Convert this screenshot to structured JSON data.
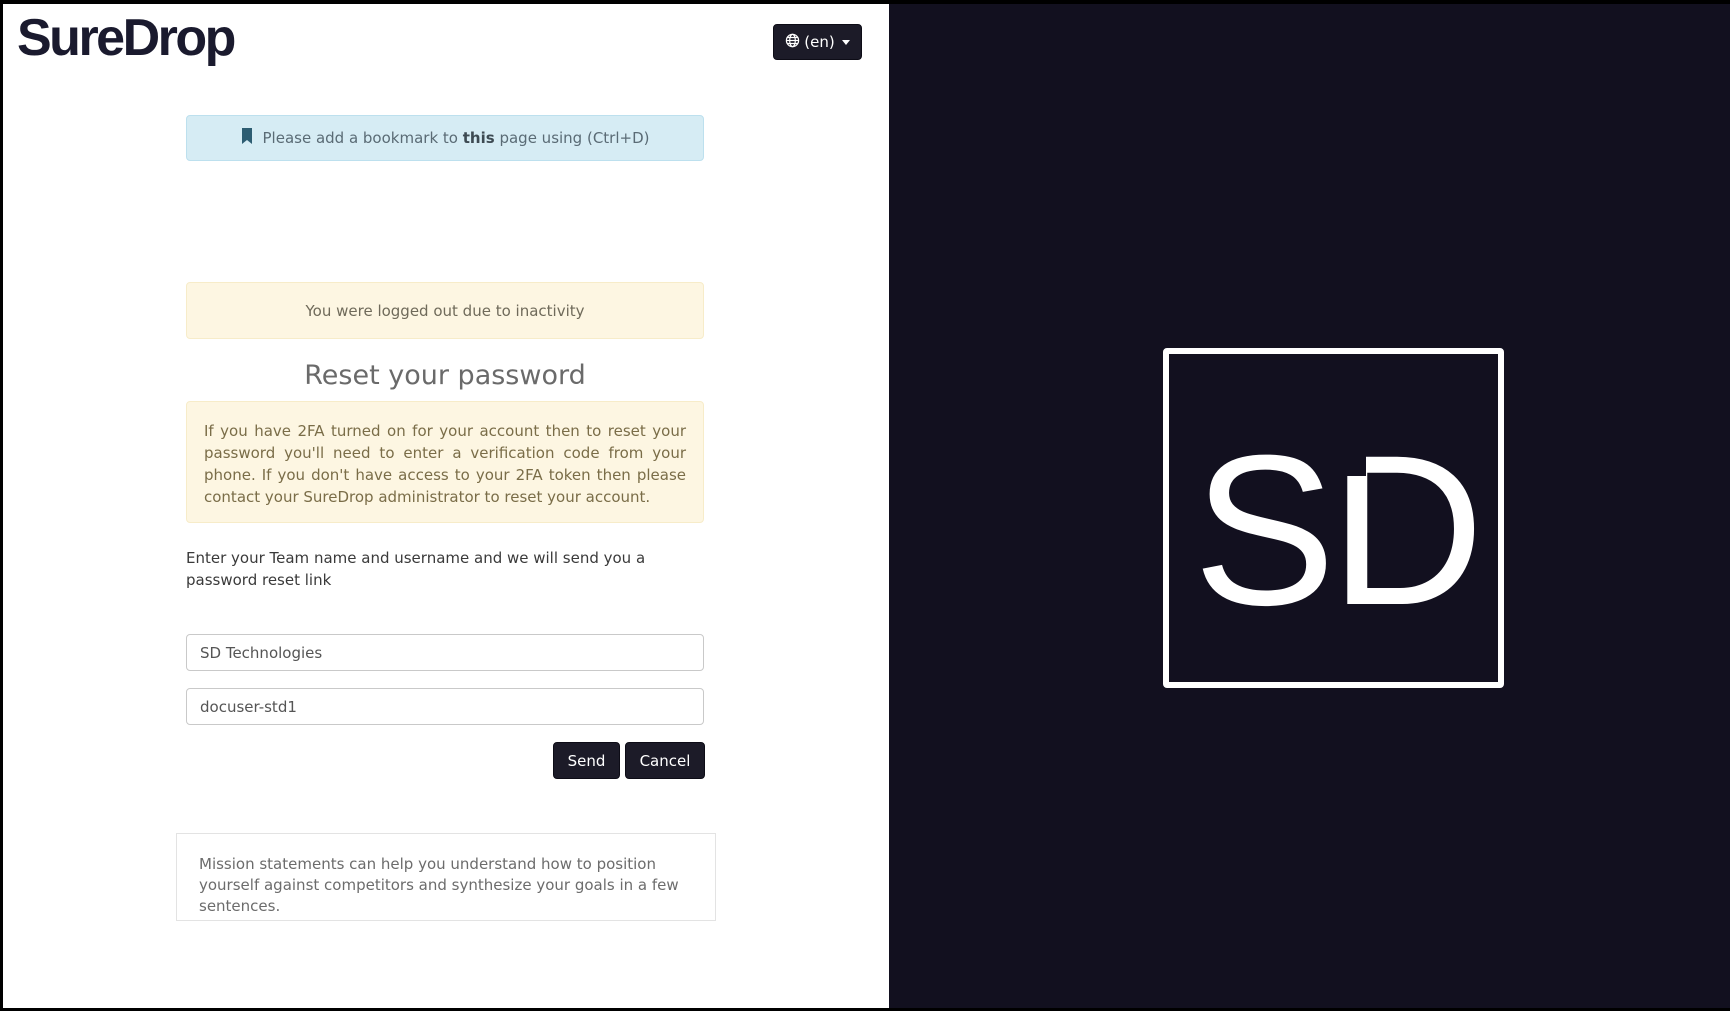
{
  "app": {
    "brand": "SureDrop"
  },
  "header": {
    "language_label": "(en)"
  },
  "alerts": {
    "bookmark_pre": "Please add a bookmark to",
    "bookmark_bold": "this",
    "bookmark_post": "page using (Ctrl+D)",
    "logged_out": "You were logged out due to inactivity",
    "twofa": "If you have 2FA turned on for your account then to reset your password you'll need to enter a verification code from your phone. If you don't have access to your 2FA token then please contact your SureDrop administrator to reset your account."
  },
  "form": {
    "title": "Reset your password",
    "instructions": "Enter your Team name and username and we will send you a password reset link",
    "team_value": "SD Technologies",
    "username_value": "docuser-std1",
    "send_label": "Send",
    "cancel_label": "Cancel"
  },
  "mission": {
    "text": "Mission statements can help you understand how to position yourself against competitors and synthesize your goals in a few sentences."
  },
  "logo": {
    "letters": "SD"
  },
  "colors": {
    "dark_panel": "#12101f",
    "button": "#1c1b28",
    "info_bg": "#d6ecf4",
    "warning_bg": "#fdf6e2"
  }
}
